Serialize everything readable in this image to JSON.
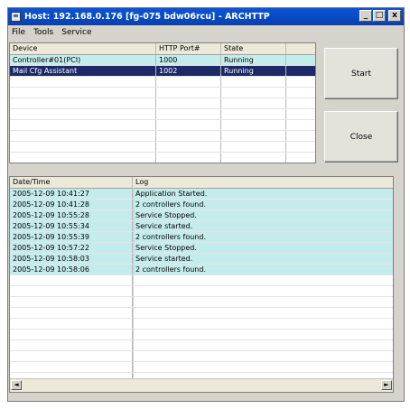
{
  "window": {
    "title": "Host: 192.168.0.176 [fg-075 bdw06rcu] - ARCHTTP",
    "minimize_label": "_",
    "maximize_label": "□",
    "close_label": "x"
  },
  "menu": {
    "items": [
      "File",
      "Tools",
      "Service"
    ]
  },
  "device_table": {
    "headers": [
      "Device",
      "HTTP Port#",
      "State",
      ""
    ],
    "rows": [
      {
        "device": "Controller#01(PCI)",
        "port": "1000",
        "state": "Running"
      },
      {
        "device": "Mail Cfg Assistant",
        "port": "1002",
        "state": "Running"
      }
    ],
    "selected_row": 1
  },
  "buttons": {
    "start": "Start",
    "close": "Close"
  },
  "log_table": {
    "headers": [
      "Date/Time",
      "Log"
    ],
    "rows": [
      {
        "time": "2005-12-09 10:41:27",
        "log": "Application Started."
      },
      {
        "time": "2005-12-09 10:41:28",
        "log": "2 controllers found."
      },
      {
        "time": "2005-12-09 10:55:28",
        "log": "Service Stopped."
      },
      {
        "time": "2005-12-09 10:55:34",
        "log": "Service started."
      },
      {
        "time": "2005-12-09 10:55:39",
        "log": "2 controllers found."
      },
      {
        "time": "2005-12-09 10:57:22",
        "log": "Service Stopped."
      },
      {
        "time": "2005-12-09 10:58:03",
        "log": "Service started."
      },
      {
        "time": "2005-12-09 10:58:06",
        "log": "2 controllers found."
      }
    ]
  },
  "scrollbar": {
    "left_arrow": "◄",
    "right_arrow": "►"
  }
}
